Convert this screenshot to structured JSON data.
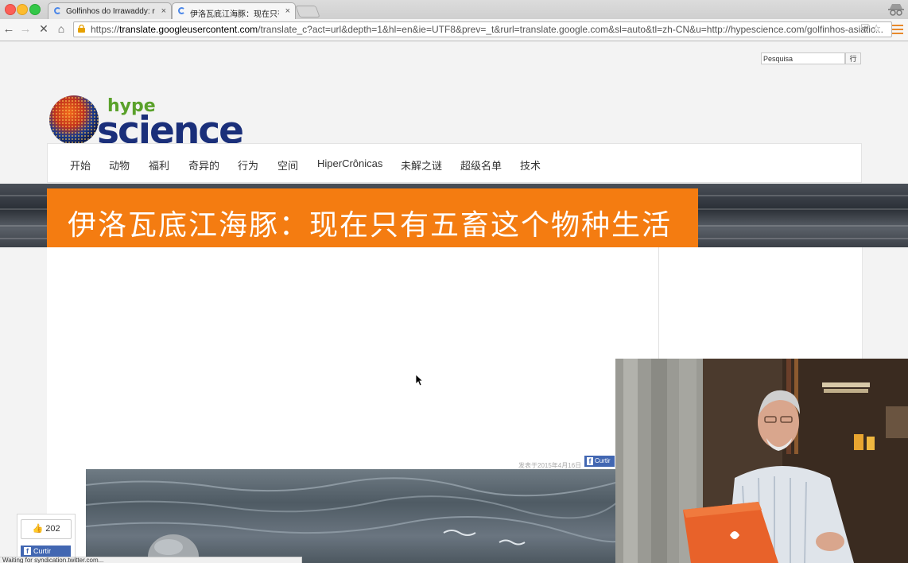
{
  "browser": {
    "tabs": [
      {
        "title": "Golfinhos do Irrawaddy: re",
        "active": false
      },
      {
        "title": "伊洛瓦底江海豚：现在只有五",
        "active": true
      }
    ],
    "tab_close": "×",
    "url_scheme": "https://",
    "url_host": "translate.googleusercontent.com",
    "url_path": "/translate_c?act=url&depth=1&hl=en&ie=UTF8&prev=_t&rurl=translate.google.com&sl=auto&tl=zh-CN&u=http://hypescience.com/golfinhos-asiatic...",
    "accent_color": "#e8892b"
  },
  "page": {
    "search_placeholder": "Pesquisa",
    "search_button": "行",
    "logo": {
      "top": "hype",
      "bottom": "science"
    },
    "nav": [
      "开始",
      "动物",
      "福利",
      "奇异的",
      "行为",
      "空间",
      "HiperCrônicas",
      "未解之谜",
      "超级名单",
      "技术"
    ],
    "article_title": "伊洛瓦底江海豚：现在只有五畜这个物种生活",
    "title_color": "#f47c11",
    "posted": "发表于2015年4月16日",
    "fb_mini_label": "Curtir",
    "like_count": "202",
    "like_button": "Curtir",
    "status": "Waiting for syndication.twitter.com..."
  }
}
